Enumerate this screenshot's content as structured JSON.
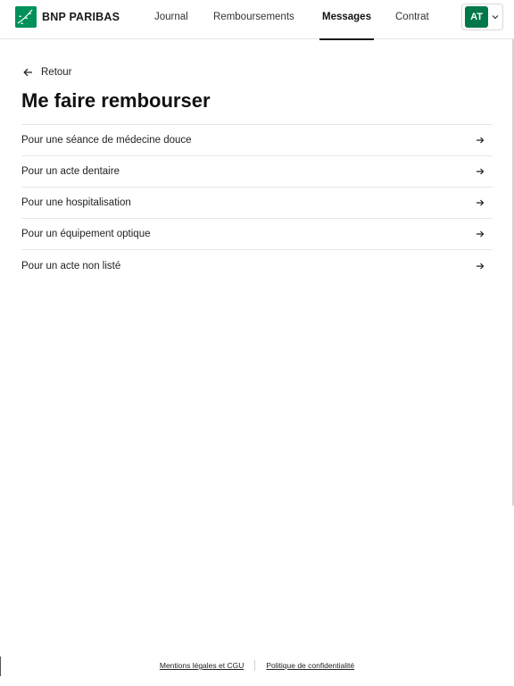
{
  "brand": {
    "name": "BNP PARIBAS"
  },
  "nav": {
    "items": [
      {
        "label": "Journal"
      },
      {
        "label": "Remboursements"
      },
      {
        "label": "Messages",
        "active": true
      },
      {
        "label": "Contrat"
      }
    ]
  },
  "account": {
    "initials": "AT"
  },
  "back": {
    "label": "Retour"
  },
  "page": {
    "title": "Me faire rembourser"
  },
  "options": [
    {
      "label": "Pour une séance de médecine douce"
    },
    {
      "label": "Pour un acte dentaire"
    },
    {
      "label": "Pour une hospitalisation"
    },
    {
      "label": "Pour un équipement optique"
    },
    {
      "label": "Pour un acte non listé"
    }
  ],
  "footer": {
    "legal": "Mentions légales et CGU",
    "privacy": "Politique de confidentialité"
  },
  "colors": {
    "brand_green": "#00915a",
    "avatar_green": "#00784a"
  }
}
